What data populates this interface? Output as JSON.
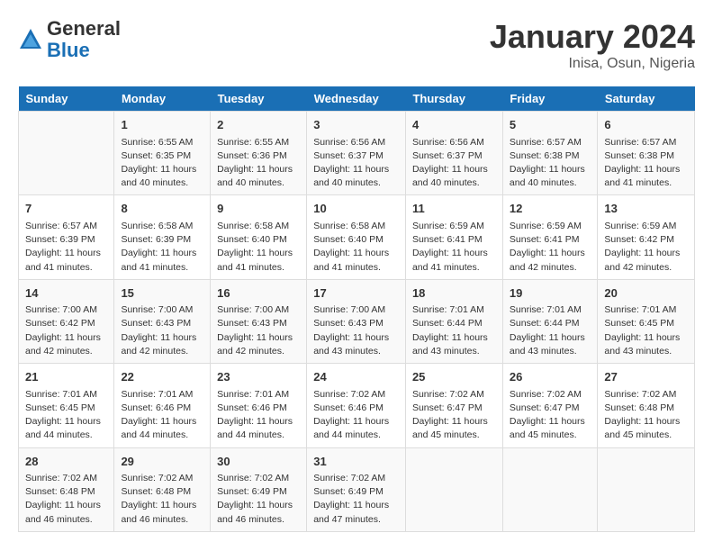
{
  "header": {
    "logo_general": "General",
    "logo_blue": "Blue",
    "month_title": "January 2024",
    "location": "Inisa, Osun, Nigeria"
  },
  "days_of_week": [
    "Sunday",
    "Monday",
    "Tuesday",
    "Wednesday",
    "Thursday",
    "Friday",
    "Saturday"
  ],
  "weeks": [
    [
      {
        "day": "",
        "info": ""
      },
      {
        "day": "1",
        "info": "Sunrise: 6:55 AM\nSunset: 6:35 PM\nDaylight: 11 hours\nand 40 minutes."
      },
      {
        "day": "2",
        "info": "Sunrise: 6:55 AM\nSunset: 6:36 PM\nDaylight: 11 hours\nand 40 minutes."
      },
      {
        "day": "3",
        "info": "Sunrise: 6:56 AM\nSunset: 6:37 PM\nDaylight: 11 hours\nand 40 minutes."
      },
      {
        "day": "4",
        "info": "Sunrise: 6:56 AM\nSunset: 6:37 PM\nDaylight: 11 hours\nand 40 minutes."
      },
      {
        "day": "5",
        "info": "Sunrise: 6:57 AM\nSunset: 6:38 PM\nDaylight: 11 hours\nand 40 minutes."
      },
      {
        "day": "6",
        "info": "Sunrise: 6:57 AM\nSunset: 6:38 PM\nDaylight: 11 hours\nand 41 minutes."
      }
    ],
    [
      {
        "day": "7",
        "info": "Sunrise: 6:57 AM\nSunset: 6:39 PM\nDaylight: 11 hours\nand 41 minutes."
      },
      {
        "day": "8",
        "info": "Sunrise: 6:58 AM\nSunset: 6:39 PM\nDaylight: 11 hours\nand 41 minutes."
      },
      {
        "day": "9",
        "info": "Sunrise: 6:58 AM\nSunset: 6:40 PM\nDaylight: 11 hours\nand 41 minutes."
      },
      {
        "day": "10",
        "info": "Sunrise: 6:58 AM\nSunset: 6:40 PM\nDaylight: 11 hours\nand 41 minutes."
      },
      {
        "day": "11",
        "info": "Sunrise: 6:59 AM\nSunset: 6:41 PM\nDaylight: 11 hours\nand 41 minutes."
      },
      {
        "day": "12",
        "info": "Sunrise: 6:59 AM\nSunset: 6:41 PM\nDaylight: 11 hours\nand 42 minutes."
      },
      {
        "day": "13",
        "info": "Sunrise: 6:59 AM\nSunset: 6:42 PM\nDaylight: 11 hours\nand 42 minutes."
      }
    ],
    [
      {
        "day": "14",
        "info": "Sunrise: 7:00 AM\nSunset: 6:42 PM\nDaylight: 11 hours\nand 42 minutes."
      },
      {
        "day": "15",
        "info": "Sunrise: 7:00 AM\nSunset: 6:43 PM\nDaylight: 11 hours\nand 42 minutes."
      },
      {
        "day": "16",
        "info": "Sunrise: 7:00 AM\nSunset: 6:43 PM\nDaylight: 11 hours\nand 42 minutes."
      },
      {
        "day": "17",
        "info": "Sunrise: 7:00 AM\nSunset: 6:43 PM\nDaylight: 11 hours\nand 43 minutes."
      },
      {
        "day": "18",
        "info": "Sunrise: 7:01 AM\nSunset: 6:44 PM\nDaylight: 11 hours\nand 43 minutes."
      },
      {
        "day": "19",
        "info": "Sunrise: 7:01 AM\nSunset: 6:44 PM\nDaylight: 11 hours\nand 43 minutes."
      },
      {
        "day": "20",
        "info": "Sunrise: 7:01 AM\nSunset: 6:45 PM\nDaylight: 11 hours\nand 43 minutes."
      }
    ],
    [
      {
        "day": "21",
        "info": "Sunrise: 7:01 AM\nSunset: 6:45 PM\nDaylight: 11 hours\nand 44 minutes."
      },
      {
        "day": "22",
        "info": "Sunrise: 7:01 AM\nSunset: 6:46 PM\nDaylight: 11 hours\nand 44 minutes."
      },
      {
        "day": "23",
        "info": "Sunrise: 7:01 AM\nSunset: 6:46 PM\nDaylight: 11 hours\nand 44 minutes."
      },
      {
        "day": "24",
        "info": "Sunrise: 7:02 AM\nSunset: 6:46 PM\nDaylight: 11 hours\nand 44 minutes."
      },
      {
        "day": "25",
        "info": "Sunrise: 7:02 AM\nSunset: 6:47 PM\nDaylight: 11 hours\nand 45 minutes."
      },
      {
        "day": "26",
        "info": "Sunrise: 7:02 AM\nSunset: 6:47 PM\nDaylight: 11 hours\nand 45 minutes."
      },
      {
        "day": "27",
        "info": "Sunrise: 7:02 AM\nSunset: 6:48 PM\nDaylight: 11 hours\nand 45 minutes."
      }
    ],
    [
      {
        "day": "28",
        "info": "Sunrise: 7:02 AM\nSunset: 6:48 PM\nDaylight: 11 hours\nand 46 minutes."
      },
      {
        "day": "29",
        "info": "Sunrise: 7:02 AM\nSunset: 6:48 PM\nDaylight: 11 hours\nand 46 minutes."
      },
      {
        "day": "30",
        "info": "Sunrise: 7:02 AM\nSunset: 6:49 PM\nDaylight: 11 hours\nand 46 minutes."
      },
      {
        "day": "31",
        "info": "Sunrise: 7:02 AM\nSunset: 6:49 PM\nDaylight: 11 hours\nand 47 minutes."
      },
      {
        "day": "",
        "info": ""
      },
      {
        "day": "",
        "info": ""
      },
      {
        "day": "",
        "info": ""
      }
    ]
  ]
}
